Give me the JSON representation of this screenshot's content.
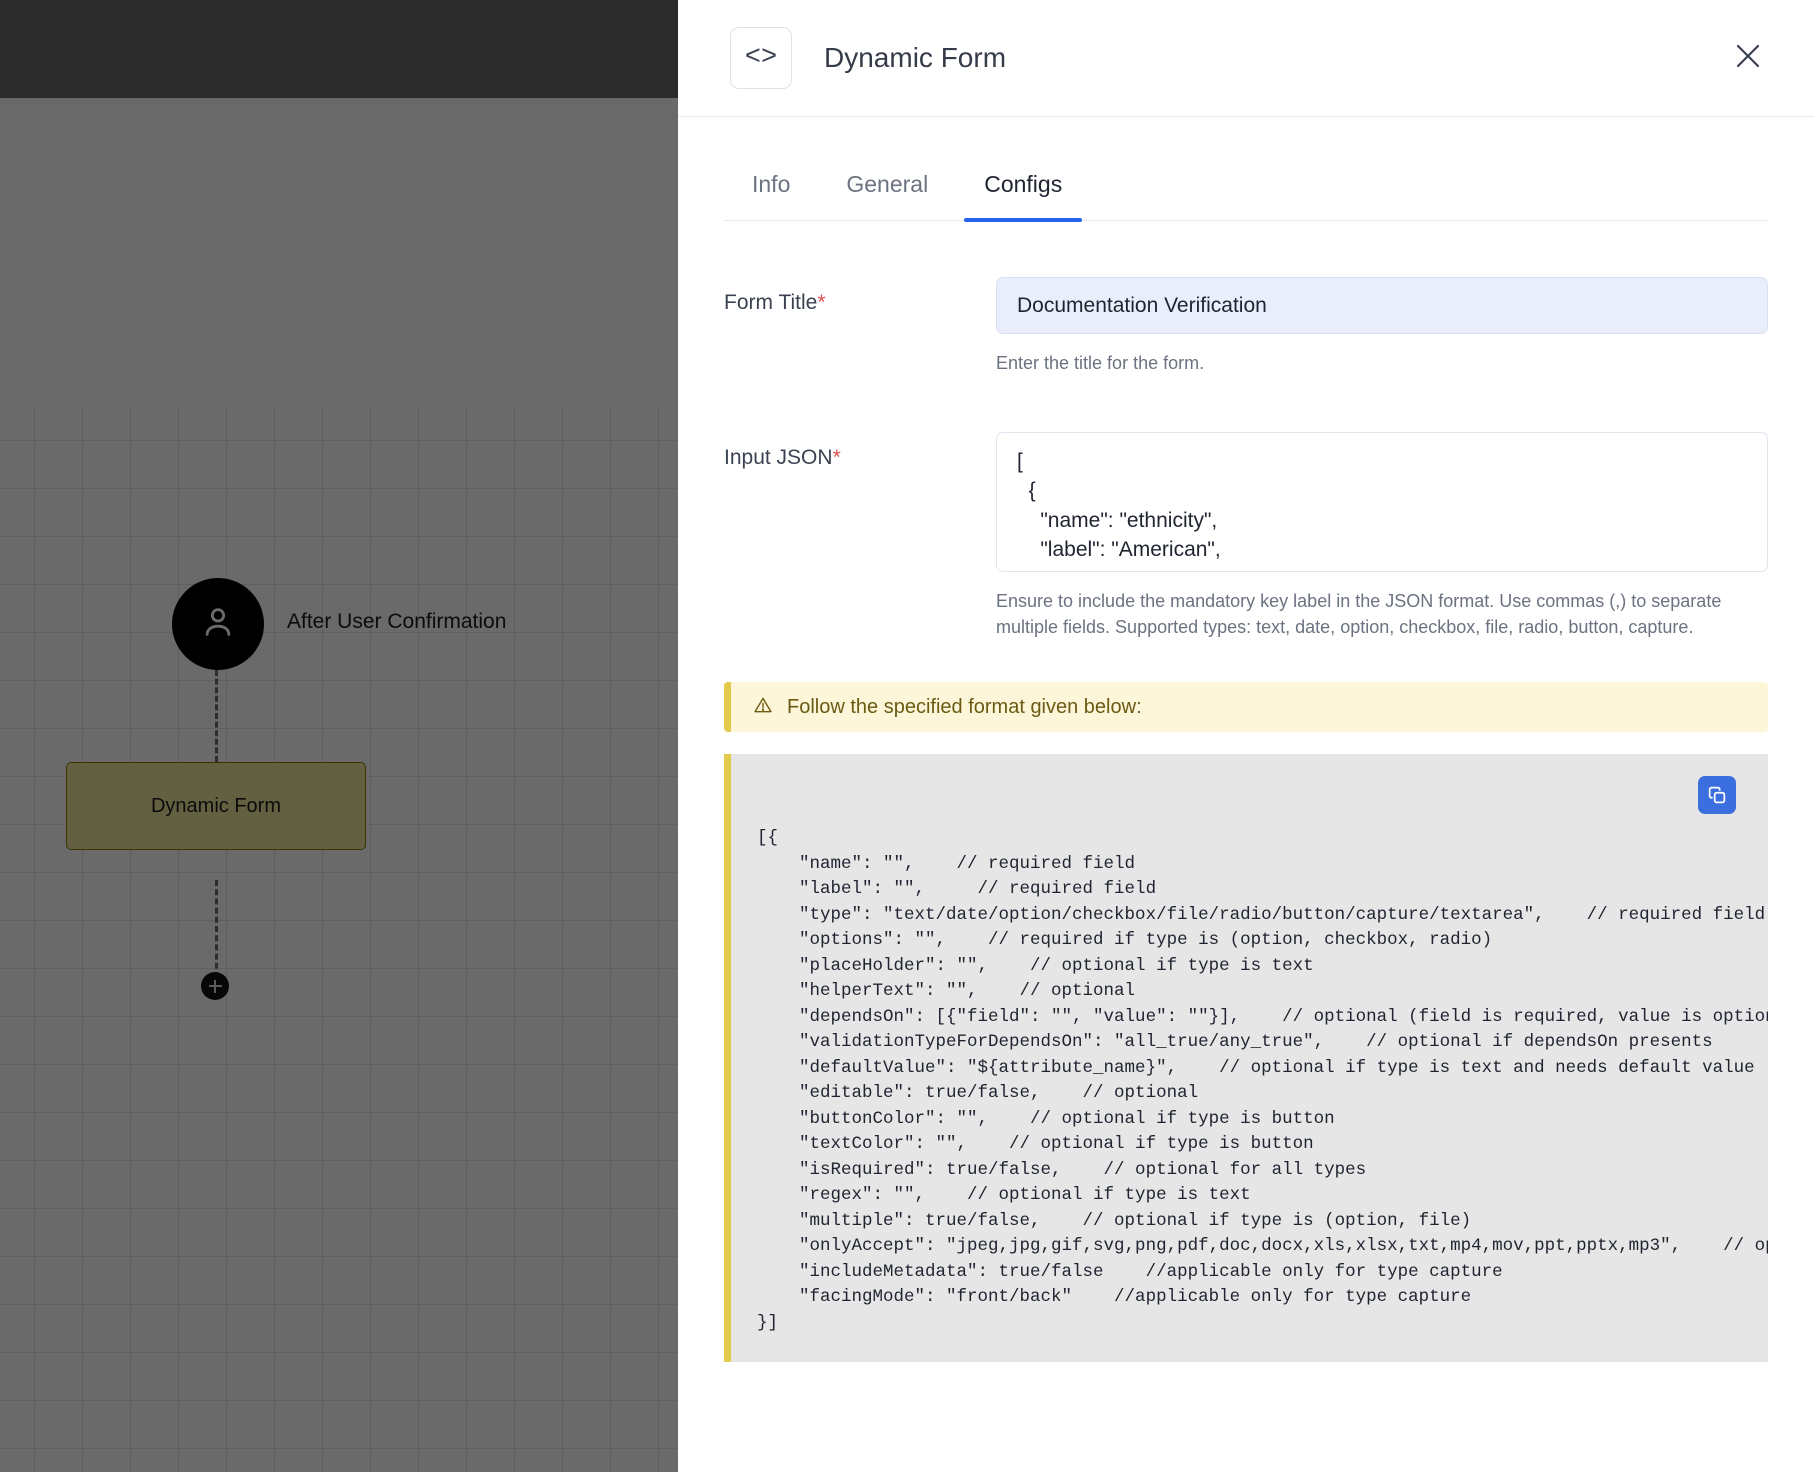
{
  "canvas": {
    "user_node_label": "After User Confirmation",
    "user_node_icon": "user-icon",
    "form_node_label": "Dynamic Form",
    "add_node_icon": "plus-icon"
  },
  "panel": {
    "header": {
      "icon": "code-brackets-icon",
      "icon_glyph": "<>",
      "title": "Dynamic Form",
      "close_icon": "close-icon"
    },
    "tabs": [
      {
        "label": "Info",
        "active": false
      },
      {
        "label": "General",
        "active": false
      },
      {
        "label": "Configs",
        "active": true
      }
    ],
    "fields": {
      "form_title": {
        "label": "Form Title",
        "required_marker": "*",
        "value": "Documentation Verification",
        "hint": "Enter the title for the form."
      },
      "input_json": {
        "label": "Input JSON",
        "required_marker": "*",
        "value": "[\n  {\n    \"name\": \"ethnicity\",\n    \"label\": \"American\",",
        "hint": "Ensure to include the mandatory key label in the JSON format. Use commas (,) to separate multiple fields. Supported types: text, date, option, checkbox, file, radio, button, capture."
      }
    },
    "warning": {
      "icon": "warning-triangle-icon",
      "text": "Follow the specified format given below:"
    },
    "code_sample": {
      "copy_icon": "copy-icon",
      "text": "[{\n    \"name\": \"\",    // required field\n    \"label\": \"\",     // required field\n    \"type\": \"text/date/option/checkbox/file/radio/button/capture/textarea\",    // required field\n    \"options\": \"\",    // required if type is (option, checkbox, radio)\n    \"placeHolder\": \"\",    // optional if type is text\n    \"helperText\": \"\",    // optional\n    \"dependsOn\": [{\"field\": \"\", \"value\": \"\"}],    // optional (field is required, value is optional)\n    \"validationTypeForDependsOn\": \"all_true/any_true\",    // optional if dependsOn presents\n    \"defaultValue\": \"${attribute_name}\",    // optional if type is text and needs default value\n    \"editable\": true/false,    // optional\n    \"buttonColor\": \"\",    // optional if type is button\n    \"textColor\": \"\",    // optional if type is button\n    \"isRequired\": true/false,    // optional for all types\n    \"regex\": \"\",    // optional if type is text\n    \"multiple\": true/false,    // optional if type is (option, file)\n    \"onlyAccept\": \"jpeg,jpg,gif,svg,png,pdf,doc,docx,xls,xlsx,txt,mp4,mov,ppt,pptx,mp3\",    // optional if\n    \"includeMetadata\": true/false    //applicable only for type capture\n    \"facingMode\": \"front/back\"    //applicable only for type capture\n}]"
    }
  },
  "colors": {
    "accent": "#2563eb",
    "warning_border": "#e2cb4c",
    "warning_bg": "#fdf6d8",
    "code_bg": "#e6e6e6",
    "input_bg": "#eaeefb",
    "required": "#d9534f",
    "node_box": "#e9e49c"
  }
}
